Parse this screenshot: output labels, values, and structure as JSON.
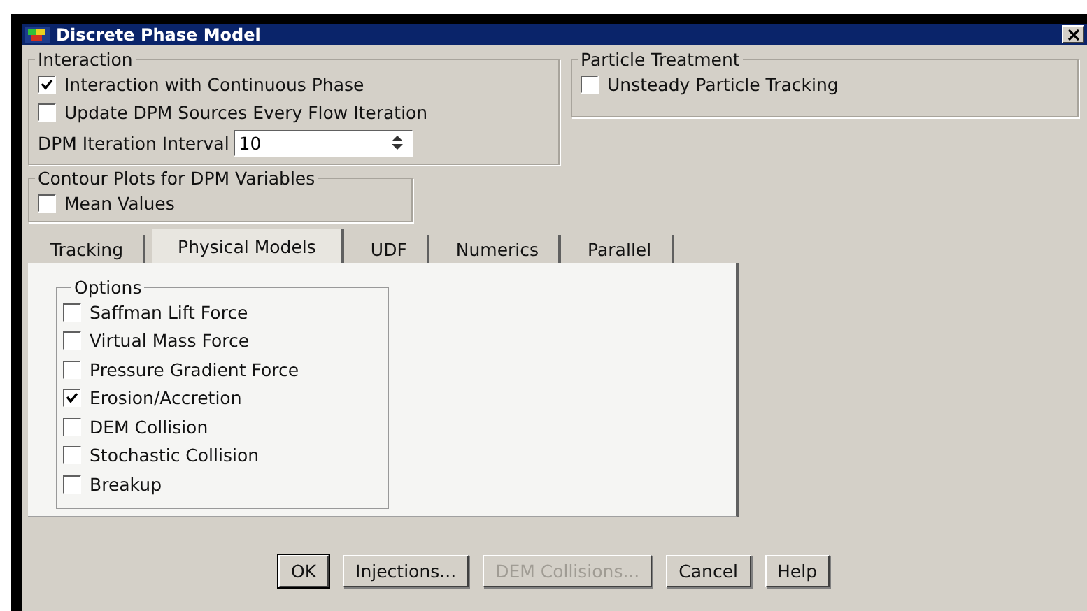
{
  "window": {
    "title": "Discrete Phase Model"
  },
  "interaction": {
    "title": "Interaction",
    "options": [
      {
        "label": "Interaction with Continuous Phase",
        "checked": true
      },
      {
        "label": "Update DPM Sources Every Flow Iteration",
        "checked": false
      }
    ],
    "interval": {
      "label": "DPM Iteration Interval",
      "value": "10"
    }
  },
  "particle_treatment": {
    "title": "Particle Treatment",
    "options": [
      {
        "label": "Unsteady Particle Tracking",
        "checked": false
      }
    ]
  },
  "contour_plots": {
    "title": "Contour Plots for DPM Variables",
    "options": [
      {
        "label": "Mean Values",
        "checked": false
      }
    ]
  },
  "tabs": [
    {
      "label": "Tracking",
      "selected": false
    },
    {
      "label": "Physical Models",
      "selected": true
    },
    {
      "label": "UDF",
      "selected": false
    },
    {
      "label": "Numerics",
      "selected": false
    },
    {
      "label": "Parallel",
      "selected": false
    }
  ],
  "options": {
    "title": "Options",
    "items": [
      {
        "label": "Saffman Lift Force",
        "checked": false
      },
      {
        "label": "Virtual Mass Force",
        "checked": false
      },
      {
        "label": "Pressure Gradient Force",
        "checked": false
      },
      {
        "label": "Erosion/Accretion",
        "checked": true
      },
      {
        "label": "DEM Collision",
        "checked": false
      },
      {
        "label": "Stochastic Collision",
        "checked": false
      },
      {
        "label": "Breakup",
        "checked": false
      }
    ]
  },
  "buttons": [
    {
      "label": "OK",
      "disabled": false,
      "default": true
    },
    {
      "label": "Injections...",
      "disabled": false,
      "default": false
    },
    {
      "label": "DEM Collisions...",
      "disabled": true,
      "default": false
    },
    {
      "label": "Cancel",
      "disabled": false,
      "default": false
    },
    {
      "label": "Help",
      "disabled": false,
      "default": false
    }
  ]
}
